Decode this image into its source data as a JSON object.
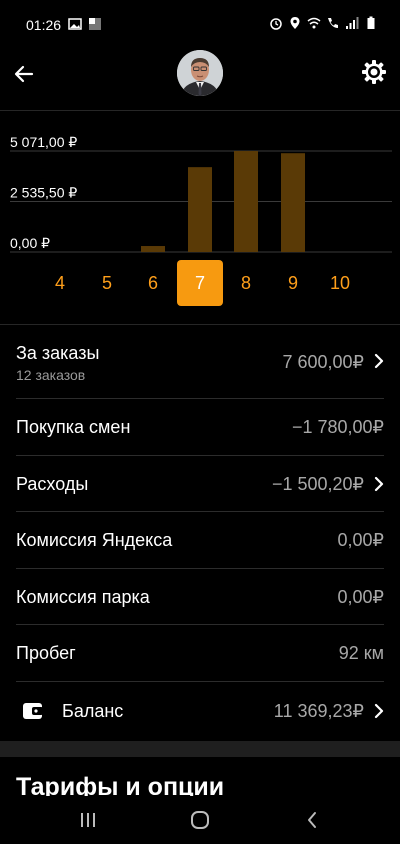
{
  "status_bar": {
    "time": "01:26",
    "icons": [
      "image-icon",
      "notification-icon",
      "alarm-icon",
      "location-icon",
      "wifi-icon",
      "call-icon",
      "signal-icon",
      "battery-icon"
    ]
  },
  "header": {
    "back_icon": "arrow-left-icon",
    "settings_icon": "gear-icon"
  },
  "colors": {
    "accent": "#f79a10",
    "bar": "#5a3a06",
    "background": "#000000",
    "muted_text": "#a8a8a8"
  },
  "chart_data": {
    "type": "bar",
    "categories": [
      "4",
      "5",
      "6",
      "7",
      "8",
      "9",
      "10"
    ],
    "values": [
      0,
      0,
      300,
      4260,
      5071,
      4960,
      0
    ],
    "yticks": [
      "0,00 ₽",
      "2 535,50 ₽",
      "5 071,00 ₽"
    ],
    "ytick_values": [
      0,
      2535.5,
      5071
    ],
    "ylim": [
      0,
      5071
    ],
    "selected": "7",
    "grid": true
  },
  "rows": {
    "orders": {
      "label": "За заказы",
      "sublabel": "12 заказов",
      "value": "7 600,00₽"
    },
    "shifts": {
      "label": "Покупка смен",
      "value": "−1 780,00₽"
    },
    "expenses": {
      "label": "Расходы",
      "value": "−1 500,20₽"
    },
    "yandex_fee": {
      "label": "Комиссия Яндекса",
      "value": "0,00₽"
    },
    "park_fee": {
      "label": "Комиссия парка",
      "value": "0,00₽"
    },
    "mileage": {
      "label": "Пробег",
      "value": "92 км"
    },
    "balance": {
      "label": "Баланс",
      "value": "11 369,23₽"
    }
  },
  "section_title": "Тарифы и опции"
}
